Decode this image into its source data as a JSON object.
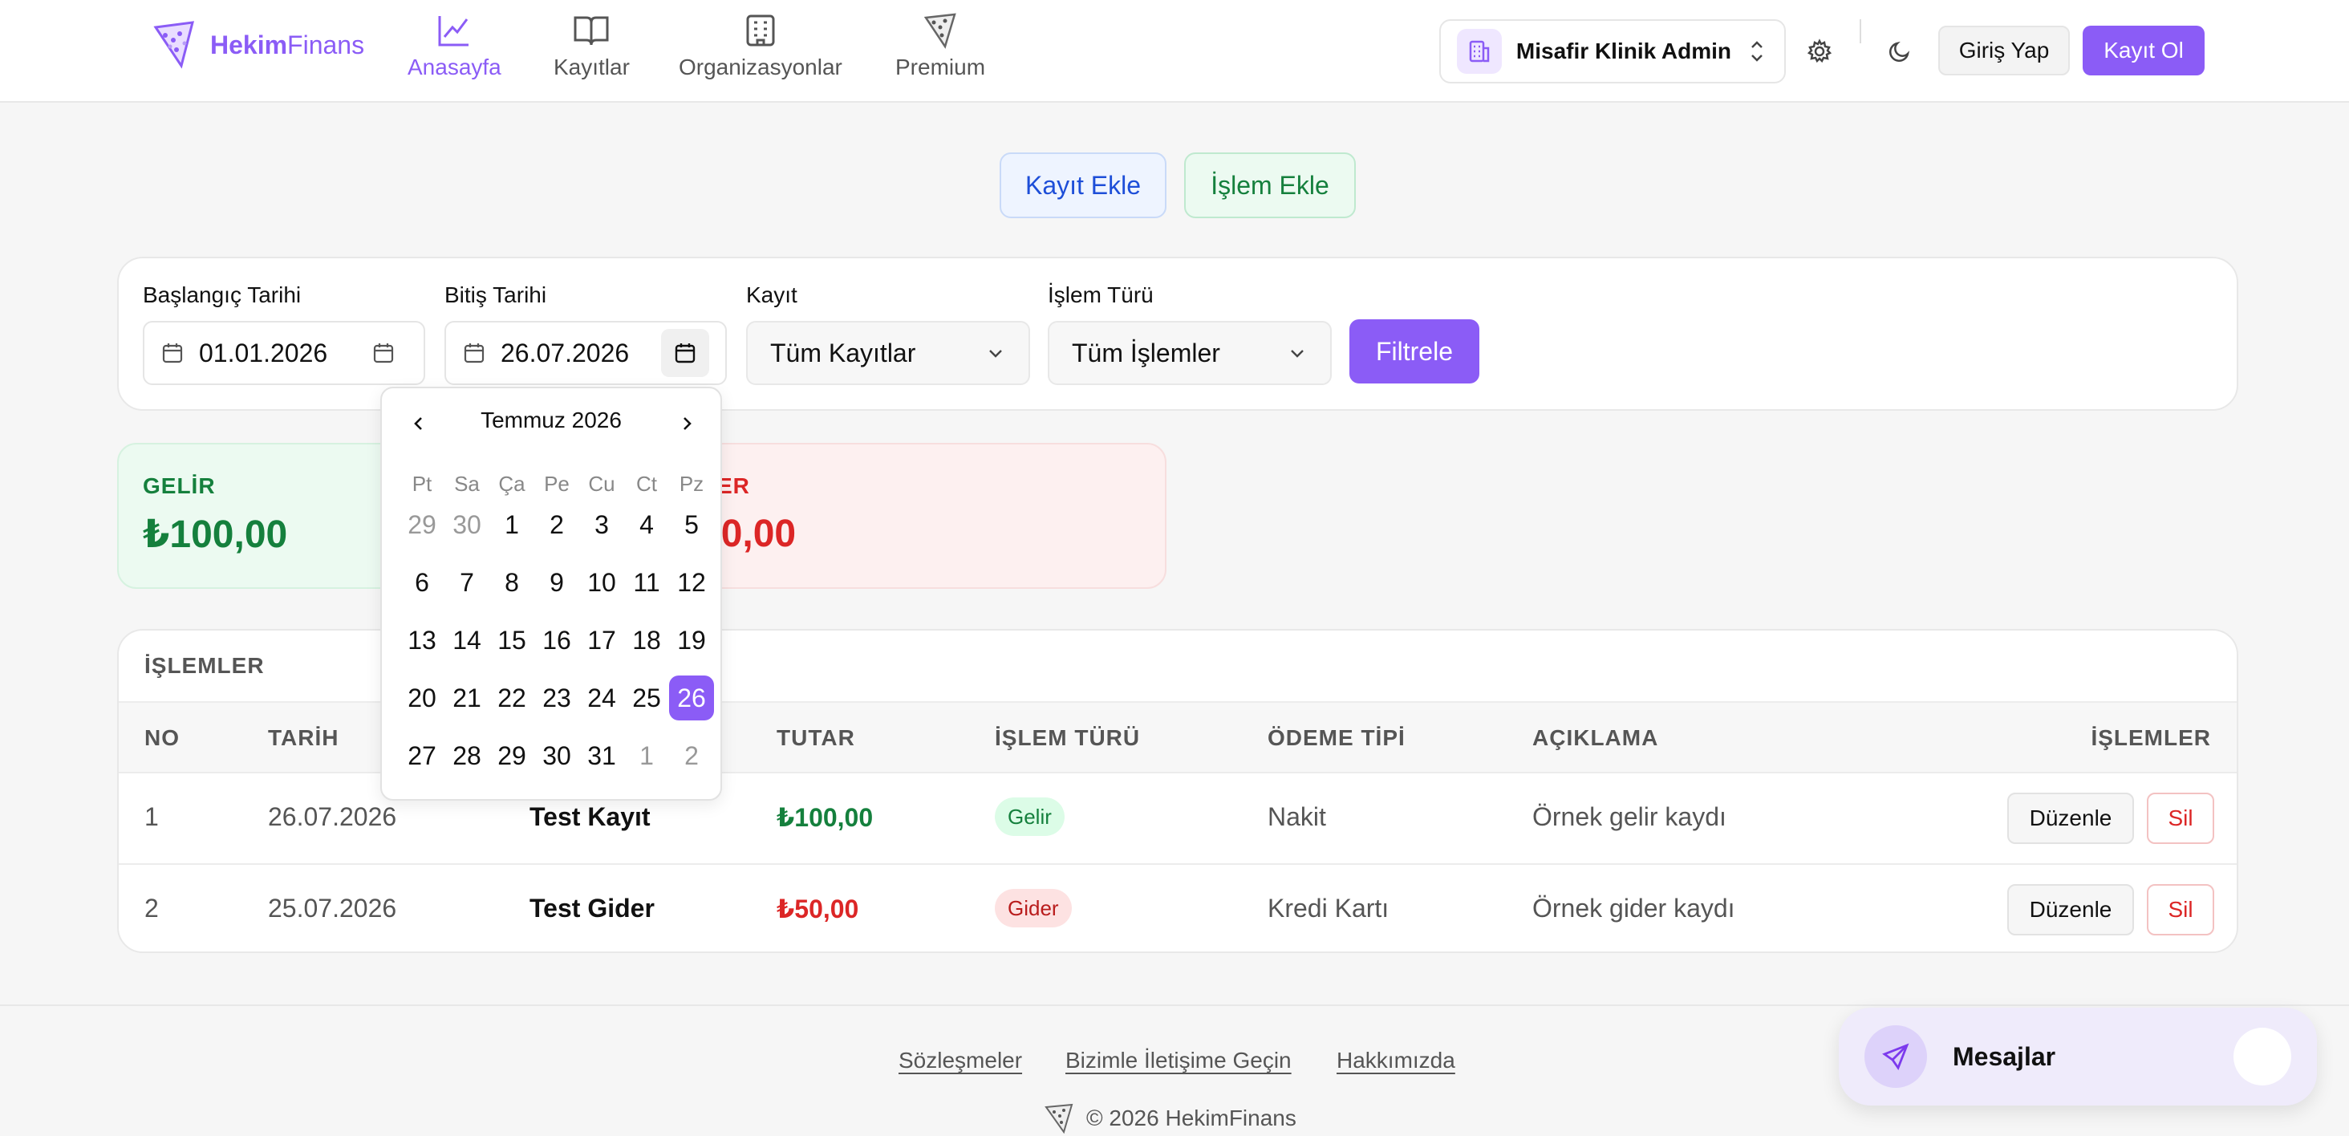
{
  "brand": {
    "name_bold": "Hekim",
    "name_light": "Finans"
  },
  "nav": [
    {
      "label": "Anasayfa",
      "icon": "line-chart-icon"
    },
    {
      "label": "Kayıtlar",
      "icon": "book-icon"
    },
    {
      "label": "Organizasyonlar",
      "icon": "building-icon"
    },
    {
      "label": "Premium",
      "icon": "premium-logo-icon"
    }
  ],
  "header": {
    "org_name": "Misafir Klinik Admin",
    "login_label": "Giriş Yap",
    "register_label": "Kayıt Ol"
  },
  "actions": {
    "add_record": "Kayıt Ekle",
    "add_transaction": "İşlem Ekle"
  },
  "filters": {
    "start_label": "Başlangıç Tarihi",
    "start_value": "01.01.2026",
    "end_label": "Bitiş Tarihi",
    "end_value": "26.07.2026",
    "record_label": "Kayıt",
    "record_value": "Tüm Kayıtlar",
    "type_label": "İşlem Türü",
    "type_value": "Tüm İşlemler",
    "filter_button": "Filtrele"
  },
  "summary": {
    "income_title": "GELİR",
    "income_value": "₺100,00",
    "expense_title_visible": "ER",
    "expense_value_visible": "50,00"
  },
  "table": {
    "title": "İŞLEMLER",
    "headers": [
      "NO",
      "TARİH",
      "TUTAR",
      "İŞLEM TÜRÜ",
      "ÖDEME TİPİ",
      "AÇIKLAMA",
      "İŞLEMLER"
    ],
    "rows": [
      {
        "no": "1",
        "date": "26.07.2026",
        "name": "Test Kayıt",
        "amount": "₺100,00",
        "type": "Gelir",
        "payment": "Nakit",
        "desc": "Örnek gelir kaydı",
        "edit": "Düzenle",
        "delete": "Sil"
      },
      {
        "no": "2",
        "date": "25.07.2026",
        "name": "Test Gider",
        "amount": "₺50,00",
        "type": "Gider",
        "payment": "Kredi Kartı",
        "desc": "Örnek gider kaydı",
        "edit": "Düzenle",
        "delete": "Sil"
      }
    ]
  },
  "datepicker": {
    "month_title": "Temmuz 2026",
    "weekdays": [
      "Pt",
      "Sa",
      "Ça",
      "Pe",
      "Cu",
      "Ct",
      "Pz"
    ],
    "weeks": [
      [
        "29",
        "30",
        "1",
        "2",
        "3",
        "4",
        "5"
      ],
      [
        "6",
        "7",
        "8",
        "9",
        "10",
        "11",
        "12"
      ],
      [
        "13",
        "14",
        "15",
        "16",
        "17",
        "18",
        "19"
      ],
      [
        "20",
        "21",
        "22",
        "23",
        "24",
        "25",
        "26"
      ],
      [
        "27",
        "28",
        "29",
        "30",
        "31",
        "1",
        "2"
      ]
    ],
    "selected": "26"
  },
  "footer": {
    "links": [
      "Sözleşmeler",
      "Bizimle İletişime Geçin",
      "Hakkımızda"
    ],
    "copyright": "© 2026 HekimFinans"
  },
  "messages": {
    "label": "Mesajlar"
  },
  "colors": {
    "accent": "#8b5cf6",
    "income": "#15803d",
    "expense": "#dc2626",
    "info": "#1d4ed8"
  }
}
